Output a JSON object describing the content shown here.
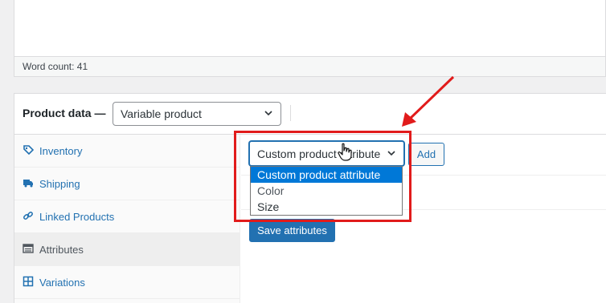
{
  "editor": {
    "word_count": "Word count: 41"
  },
  "product_data": {
    "title": "Product data —",
    "type_select": {
      "value": "Variable product"
    }
  },
  "tabs": [
    {
      "label": "Inventory",
      "icon": "tag-icon",
      "active": false
    },
    {
      "label": "Shipping",
      "icon": "truck-icon",
      "active": false
    },
    {
      "label": "Linked Products",
      "icon": "link-icon",
      "active": false
    },
    {
      "label": "Attributes",
      "icon": "list-icon",
      "active": true
    },
    {
      "label": "Variations",
      "icon": "grid-icon",
      "active": false
    }
  ],
  "attributes_panel": {
    "attribute_select": {
      "value": "Custom product attribute",
      "options": [
        "Custom product attribute",
        "Color",
        "Size"
      ]
    },
    "add_label": "Add",
    "save_label": "Save attributes"
  },
  "colors": {
    "accent": "#2271b1",
    "annotation": "#e11b1b",
    "selected_option": "#0078d7"
  }
}
